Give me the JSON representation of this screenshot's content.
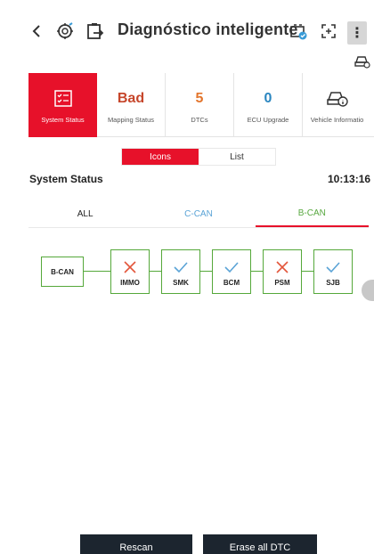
{
  "header": {
    "title": "Diagnóstico inteligente",
    "icons": [
      "back-icon",
      "ecu-icon",
      "car-report-icon",
      "battery-icon",
      "fullscreen-icon",
      "more-icon"
    ]
  },
  "status_tabs": [
    {
      "value": "",
      "label": "System Status",
      "icon": "system-status-icon",
      "active": true
    },
    {
      "value": "Bad",
      "label": "Mapping Status",
      "color": "#c6462b"
    },
    {
      "value": "5",
      "label": "DTCs",
      "color": "#e3752c"
    },
    {
      "value": "0",
      "label": "ECU Upgrade",
      "color": "#2a86c0"
    },
    {
      "value": "",
      "label": "Vehicle Informatio",
      "icon": "vehicle-info-icon"
    }
  ],
  "view_toggle": {
    "icons": "Icons",
    "list": "List",
    "selected": "Icons"
  },
  "system_status": {
    "title": "System Status",
    "time": "10:13:16"
  },
  "can_tabs": [
    {
      "label": "ALL"
    },
    {
      "label": "C-CAN"
    },
    {
      "label": "B-CAN",
      "selected": true
    }
  ],
  "topology": {
    "root": "B-CAN",
    "modules": [
      {
        "name": "IMMO",
        "status": "error"
      },
      {
        "name": "SMK",
        "status": "ok"
      },
      {
        "name": "BCM",
        "status": "ok"
      },
      {
        "name": "PSM",
        "status": "error"
      },
      {
        "name": "SJB",
        "status": "ok"
      }
    ]
  },
  "buttons": {
    "rescan": "Rescan",
    "erase": "Erase all DTC"
  },
  "colors": {
    "accent": "#e7112a",
    "ok": "#5aa3d6",
    "error": "#e3563b",
    "node_border": "#55a83a",
    "button_bg": "#1c252f"
  }
}
